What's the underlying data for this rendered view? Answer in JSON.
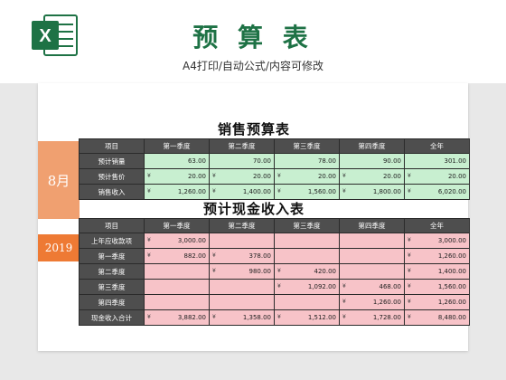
{
  "header": {
    "title": "预 算 表",
    "subtitle": "A4打印/自动公式/内容可修改",
    "logo_letter": "X",
    "brand_color": "#1e7245"
  },
  "side": {
    "month": "8月",
    "year": "2019",
    "month_color": "#f0a070",
    "year_color": "#ee7a34"
  },
  "sales": {
    "title": "销售预算表",
    "columns": [
      "项目",
      "第一季度",
      "第二季度",
      "第三季度",
      "第四季度",
      "全年"
    ],
    "cell_color": "#c8efd0",
    "rows": [
      {
        "label": "预计销量",
        "cells": [
          {
            "cur": "",
            "amt": "63.00"
          },
          {
            "cur": "",
            "amt": "70.00"
          },
          {
            "cur": "",
            "amt": "78.00"
          },
          {
            "cur": "",
            "amt": "90.00"
          },
          {
            "cur": "",
            "amt": "301.00"
          }
        ]
      },
      {
        "label": "预计售价",
        "cells": [
          {
            "cur": "¥",
            "amt": "20.00"
          },
          {
            "cur": "¥",
            "amt": "20.00"
          },
          {
            "cur": "¥",
            "amt": "20.00"
          },
          {
            "cur": "¥",
            "amt": "20.00"
          },
          {
            "cur": "¥",
            "amt": "20.00"
          }
        ]
      },
      {
        "label": "销售收入",
        "cells": [
          {
            "cur": "¥",
            "amt": "1,260.00"
          },
          {
            "cur": "¥",
            "amt": "1,400.00"
          },
          {
            "cur": "¥",
            "amt": "1,560.00"
          },
          {
            "cur": "¥",
            "amt": "1,800.00"
          },
          {
            "cur": "¥",
            "amt": "6,020.00"
          }
        ]
      }
    ]
  },
  "cash": {
    "title": "预计现金收入表",
    "columns": [
      "项目",
      "第一季度",
      "第二季度",
      "第三季度",
      "第四季度",
      "全年"
    ],
    "cell_color": "#f7c3c8",
    "rows": [
      {
        "label": "上年应收款项",
        "cells": [
          {
            "cur": "¥",
            "amt": "3,000.00"
          },
          {
            "cur": "",
            "amt": ""
          },
          {
            "cur": "",
            "amt": ""
          },
          {
            "cur": "",
            "amt": ""
          },
          {
            "cur": "¥",
            "amt": "3,000.00"
          }
        ]
      },
      {
        "label": "第一季度",
        "cells": [
          {
            "cur": "¥",
            "amt": "882.00"
          },
          {
            "cur": "¥",
            "amt": "378.00"
          },
          {
            "cur": "",
            "amt": ""
          },
          {
            "cur": "",
            "amt": ""
          },
          {
            "cur": "¥",
            "amt": "1,260.00"
          }
        ]
      },
      {
        "label": "第二季度",
        "cells": [
          {
            "cur": "",
            "amt": ""
          },
          {
            "cur": "¥",
            "amt": "980.00"
          },
          {
            "cur": "¥",
            "amt": "420.00"
          },
          {
            "cur": "",
            "amt": ""
          },
          {
            "cur": "¥",
            "amt": "1,400.00"
          }
        ]
      },
      {
        "label": "第三季度",
        "cells": [
          {
            "cur": "",
            "amt": ""
          },
          {
            "cur": "",
            "amt": ""
          },
          {
            "cur": "¥",
            "amt": "1,092.00"
          },
          {
            "cur": "¥",
            "amt": "468.00"
          },
          {
            "cur": "¥",
            "amt": "1,560.00"
          }
        ]
      },
      {
        "label": "第四季度",
        "cells": [
          {
            "cur": "",
            "amt": ""
          },
          {
            "cur": "",
            "amt": ""
          },
          {
            "cur": "",
            "amt": ""
          },
          {
            "cur": "¥",
            "amt": "1,260.00"
          },
          {
            "cur": "¥",
            "amt": "1,260.00"
          }
        ]
      },
      {
        "label": "现金收入合计",
        "cells": [
          {
            "cur": "¥",
            "amt": "3,882.00"
          },
          {
            "cur": "¥",
            "amt": "1,358.00"
          },
          {
            "cur": "¥",
            "amt": "1,512.00"
          },
          {
            "cur": "¥",
            "amt": "1,728.00"
          },
          {
            "cur": "¥",
            "amt": "8,480.00"
          }
        ]
      }
    ]
  }
}
